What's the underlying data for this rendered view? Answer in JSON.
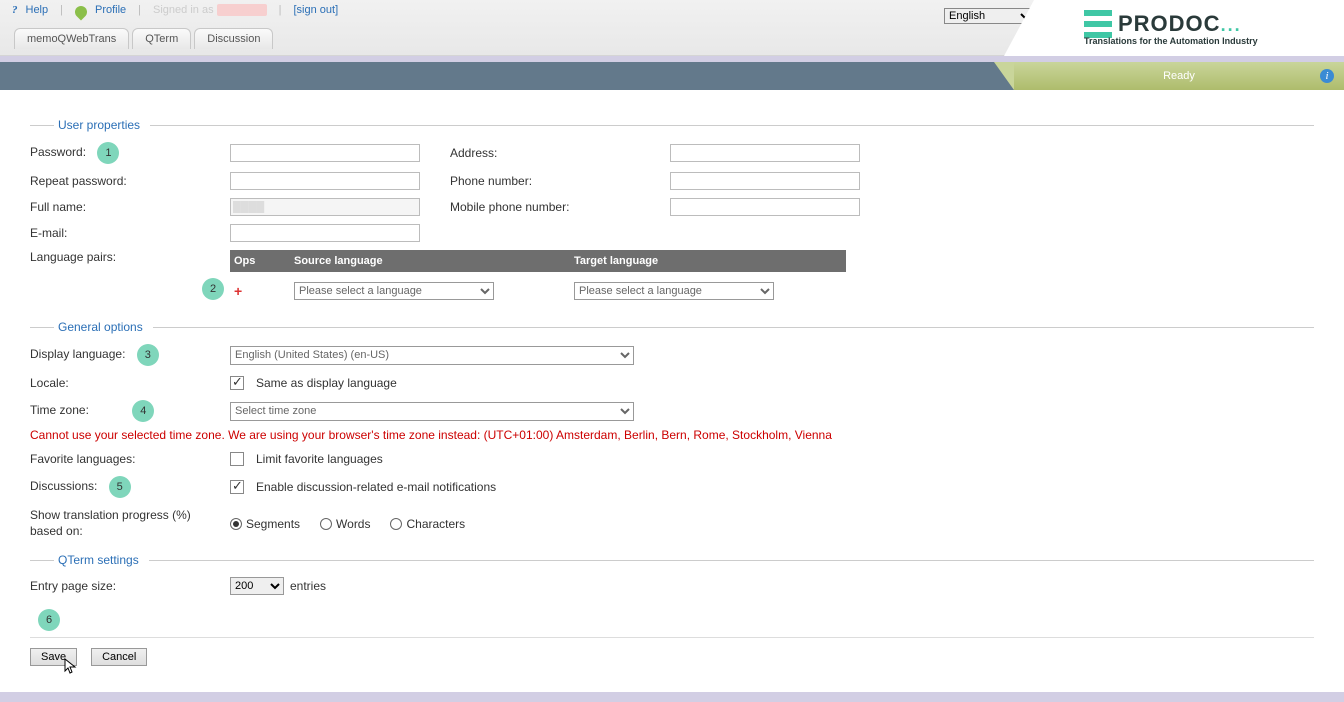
{
  "topbar": {
    "help": "Help",
    "profile": "Profile",
    "signed_prefix": "Signed in as",
    "signout": "[sign out]",
    "lang_selected": "English"
  },
  "logo": {
    "name": "PRODOC",
    "tagline": "Translations for the Automation Industry"
  },
  "tabs": {
    "t1": "memoQWebTrans",
    "t2": "QTerm",
    "t3": "Discussion"
  },
  "status": {
    "ready": "Ready"
  },
  "sections": {
    "user_props": "User properties",
    "general": "General options",
    "qterm": "QTerm settings"
  },
  "labels": {
    "password": "Password:",
    "repeat_password": "Repeat password:",
    "full_name": "Full name:",
    "email": "E-mail:",
    "lang_pairs": "Language pairs:",
    "address": "Address:",
    "phone": "Phone number:",
    "mobile": "Mobile phone number:",
    "ops": "Ops",
    "src_lang": "Source language",
    "tgt_lang": "Target language",
    "select_lang": "Please select a language",
    "display_lang": "Display language:",
    "locale": "Locale:",
    "timezone": "Time zone:",
    "fav_langs": "Favorite languages:",
    "discussions": "Discussions:",
    "show_prog": "Show translation progress (%) based on:",
    "entry_page_size": "Entry page size:",
    "entries": "entries"
  },
  "values": {
    "display_lang": "English (United States) (en-US)",
    "locale_same": "Same as display language",
    "timezone_sel": "Select time zone",
    "limit_fav": "Limit favorite languages",
    "enable_disc": "Enable discussion-related e-mail notifications",
    "seg": "Segments",
    "words": "Words",
    "chars": "Characters",
    "page_size": "200"
  },
  "warning": "Cannot use your selected time zone. We are using your browser's time zone instead: (UTC+01:00) Amsterdam, Berlin, Bern, Rome, Stockholm, Vienna",
  "buttons": {
    "save": "Save",
    "cancel": "Cancel"
  },
  "annotations": {
    "a1": "1",
    "a2": "2",
    "a3": "3",
    "a4": "4",
    "a5": "5",
    "a6": "6"
  }
}
